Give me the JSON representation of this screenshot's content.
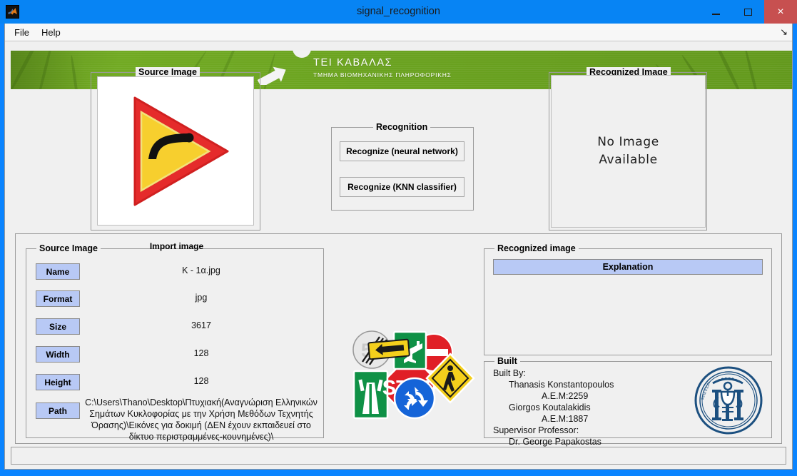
{
  "window": {
    "title": "signal_recognition",
    "app_icon": "matlab-icon",
    "minimize_label": "",
    "maximize_label": "",
    "close_label": "×",
    "titlebar_color": "#0784f4",
    "close_button_color": "#c75050"
  },
  "menubar": {
    "items": [
      {
        "label": "File",
        "name": "menu-file"
      },
      {
        "label": "Help",
        "name": "menu-help"
      }
    ],
    "undock_icon": "undock-arrow-icon",
    "undock_glyph": "↘"
  },
  "banner": {
    "title": "ΤΕΙ ΚΑΒΑΛΑΣ",
    "subtitle": "ΤΜΗΜΑ ΒΙΟΜΗΧΑΝΙΚΗΣ ΠΛΗΡΟΦΟΡΙΚΗΣ",
    "background_color": "#6aa521",
    "text_color": "#ffffff",
    "arrow_icon": "white-arrow-icon"
  },
  "source_panel": {
    "title": "Source Image",
    "image_name": "rotated-warning-triangle-sign",
    "image_colors": {
      "border": "#e52b2b",
      "fill": "#f7cf2e",
      "symbol": "#111111"
    }
  },
  "recognition_panel": {
    "title": "Recognition",
    "buttons": [
      {
        "label": "Recognize (neural network)",
        "name": "recognize-neural-network-button"
      },
      {
        "label": "Recognize (KNN classifier)",
        "name": "recognize-knn-classifier-button"
      }
    ]
  },
  "recognized_panel": {
    "title": "Recognized Image",
    "placeholder_line1": "No Image",
    "placeholder_line2": "Available"
  },
  "import": {
    "label": "Import image",
    "focused": true,
    "background_color": "#d9e7fb"
  },
  "source_details": {
    "title": "Source Image",
    "rows": [
      {
        "label": "Name",
        "value": "K - 1α.jpg",
        "name": "source-name"
      },
      {
        "label": "Format",
        "value": "jpg",
        "name": "source-format"
      },
      {
        "label": "Size",
        "value": "3617",
        "name": "source-size"
      },
      {
        "label": "Width",
        "value": "128",
        "name": "source-width"
      },
      {
        "label": "Height",
        "value": "128",
        "name": "source-height"
      }
    ],
    "path_label": "Path",
    "path_value": "C:\\Users\\Thano\\Desktop\\Πτυχιακή(Αναγνώριση Ελληνικών Σημάτων Κυκλοφορίας με την Χρήση Μεθόδων Τεχνητής Όρασης)\\Εικόνες για δοκιμή (ΔΕΝ έχουν εκπαιδευεί στο δίκτυο περιστραμμένες-κουνημένες)\\"
  },
  "collage": {
    "name": "traffic-signs-collage",
    "signs": [
      "end-of-restriction-sign",
      "yellow-left-arrow-sign",
      "green-airport-sign",
      "green-motorway-sign",
      "stop-sign",
      "no-entry-sign",
      "pedestrian-crossing-sign",
      "roundabout-sign"
    ],
    "stop_text": "STOP"
  },
  "recognized_bottom": {
    "title": "Recognized image",
    "explanation_label": "Explanation",
    "explanation_color": "#b8c9f5"
  },
  "built": {
    "title": "Built",
    "lines": [
      {
        "text": "Built By:",
        "indent": 0
      },
      {
        "text": "Thanasis Konstantopoulos",
        "indent": 1
      },
      {
        "text": "A.E.M:2259",
        "indent": 2
      },
      {
        "text": "Giorgos Koutalakidis",
        "indent": 1
      },
      {
        "text": "A.E.M:1887",
        "indent": 2
      },
      {
        "text": "Supervisor Professor:",
        "indent": 0
      },
      {
        "text": "Dr. George Papakostas",
        "indent": 1
      }
    ],
    "seal_name": "tei-kavalas-seal",
    "seal_color": "#1c5080"
  }
}
